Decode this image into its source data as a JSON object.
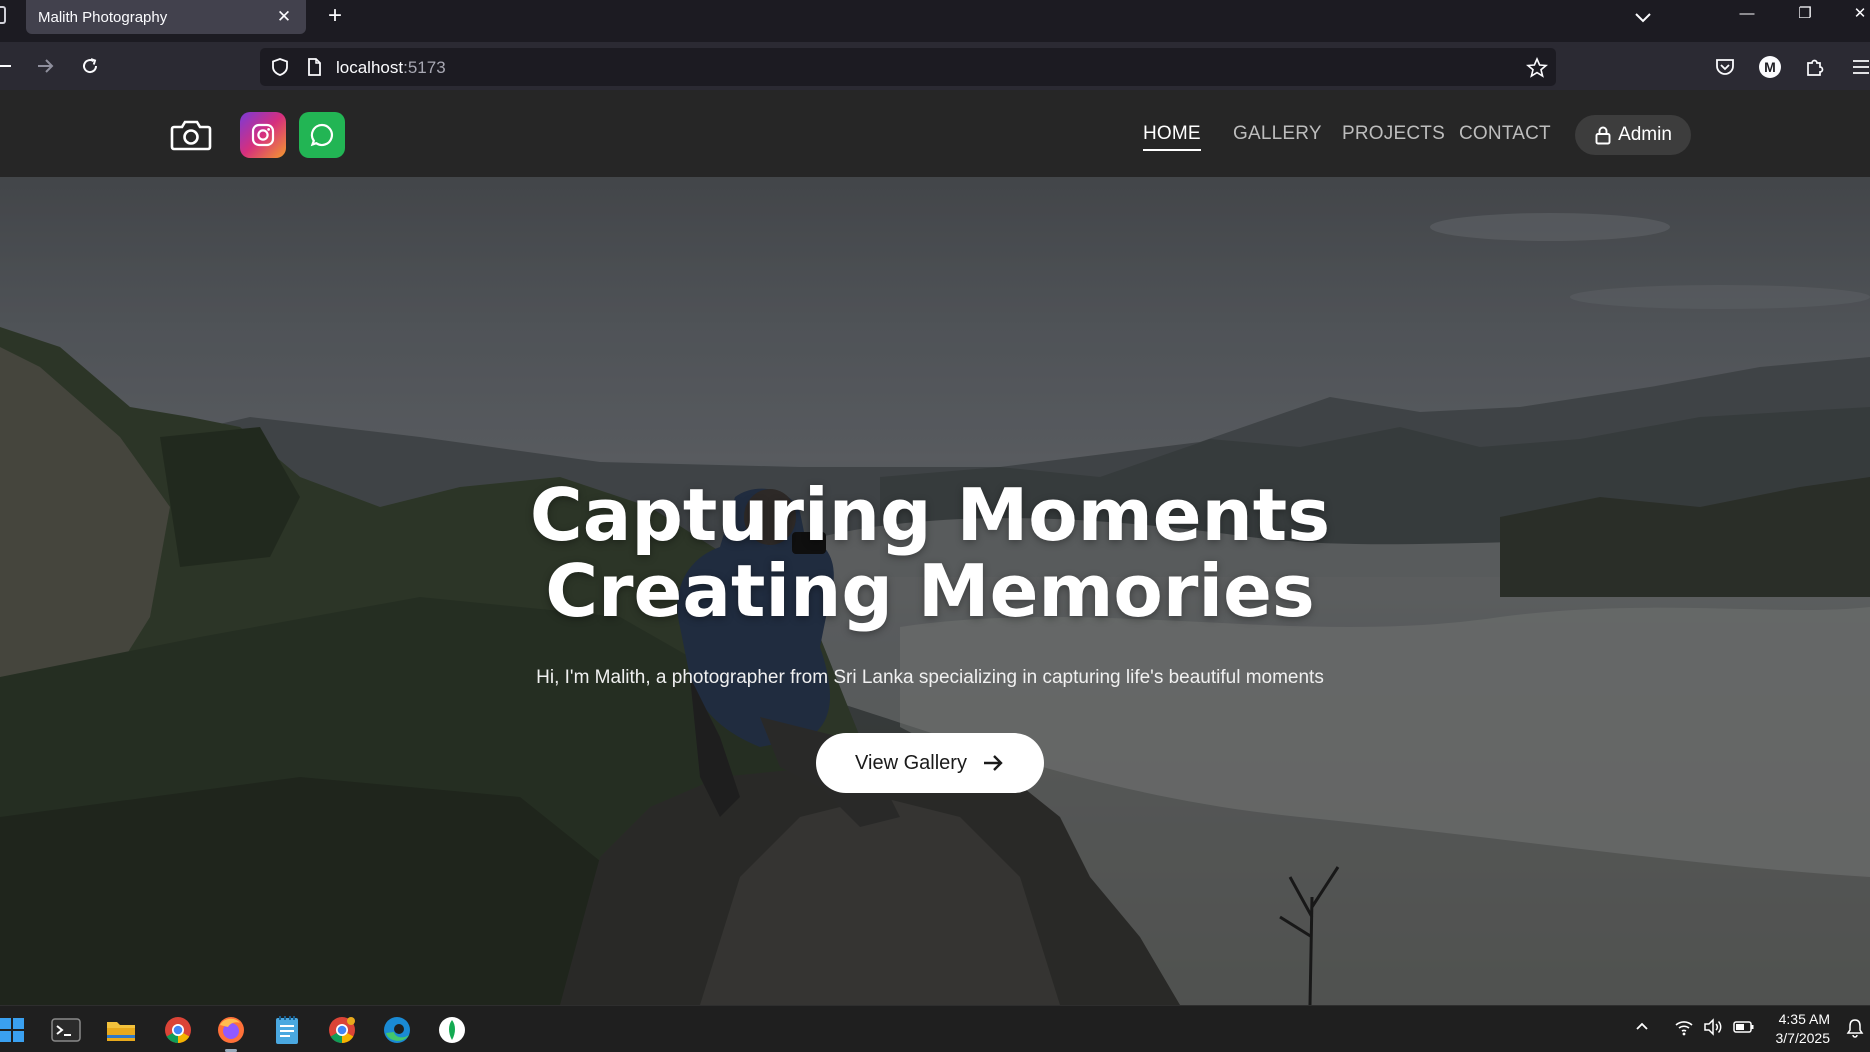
{
  "browser": {
    "tab_title": "Malith Photography",
    "new_tab_label": "+",
    "url_host": "localhost",
    "url_port": ":5173",
    "profile_initial": "M"
  },
  "site": {
    "nav": {
      "items": [
        {
          "label": "HOME",
          "active": true
        },
        {
          "label": "GALLERY",
          "active": false
        },
        {
          "label": "PROJECTS",
          "active": false
        },
        {
          "label": "CONTACT",
          "active": false
        }
      ],
      "admin_label": "Admin"
    },
    "hero": {
      "title_line1": "Capturing Moments",
      "title_line2": "Creating Memories",
      "subtitle": "Hi, I'm Malith, a photographer from Sri Lanka specializing in capturing life's beautiful moments",
      "cta_label": "View Gallery"
    },
    "icons": [
      "camera-icon",
      "instagram-icon",
      "whatsapp-icon",
      "lock-icon",
      "arrow-right-icon"
    ],
    "colors": {
      "header_bg": "#262626",
      "instagram": "#d62f7d",
      "whatsapp": "#22b554",
      "cta_bg": "#ffffff"
    }
  },
  "taskbar": {
    "apps": [
      "start-icon",
      "terminal-icon",
      "file-explorer-icon",
      "chrome-icon",
      "firefox-icon",
      "notepad-icon",
      "chrome-icon",
      "edge-icon",
      "mongodb-compass-icon"
    ],
    "time": "4:35 AM",
    "date": "3/7/2025"
  }
}
